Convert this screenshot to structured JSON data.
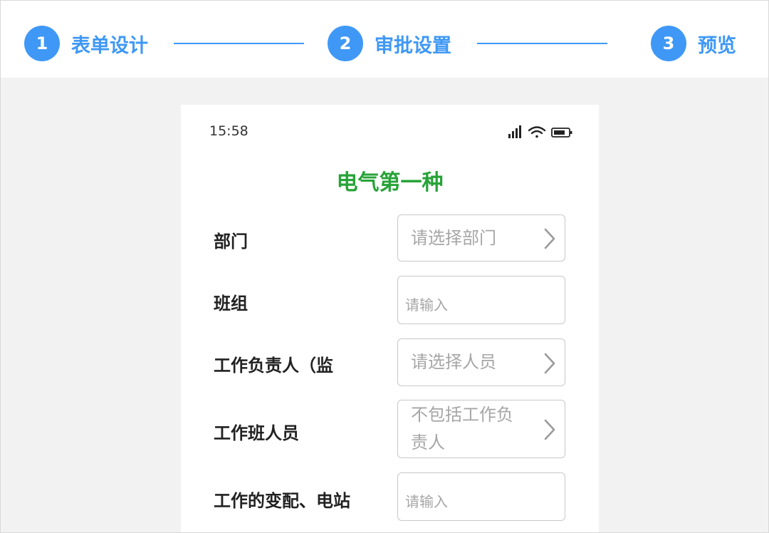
{
  "stepper": {
    "steps": [
      {
        "number": "1",
        "label": "表单设计"
      },
      {
        "number": "2",
        "label": "审批设置"
      },
      {
        "number": "3",
        "label": "预览"
      }
    ]
  },
  "phone": {
    "status_time": "15:58",
    "title": "电气第一种",
    "fields": [
      {
        "label": "部门",
        "type": "select",
        "placeholder": "请选择部门",
        "icon": "chevron-right-icon"
      },
      {
        "label": "班组",
        "type": "input",
        "placeholder": "请输入"
      },
      {
        "label": "工作负责人（监",
        "type": "select",
        "placeholder": "请选择人员",
        "icon": "chevron-right-icon"
      },
      {
        "label": "工作班人员",
        "type": "select",
        "placeholder_line1": "不包括工作负",
        "placeholder_line2": "责人",
        "icon": "chevron-right-icon"
      },
      {
        "label": "工作的变配、电站",
        "type": "input",
        "placeholder": "请输入"
      }
    ]
  },
  "colors": {
    "accent": "#3f98f5",
    "title_green": "#27a338",
    "placeholder": "#a6a6a6",
    "page_bg": "#f2f2f2"
  }
}
